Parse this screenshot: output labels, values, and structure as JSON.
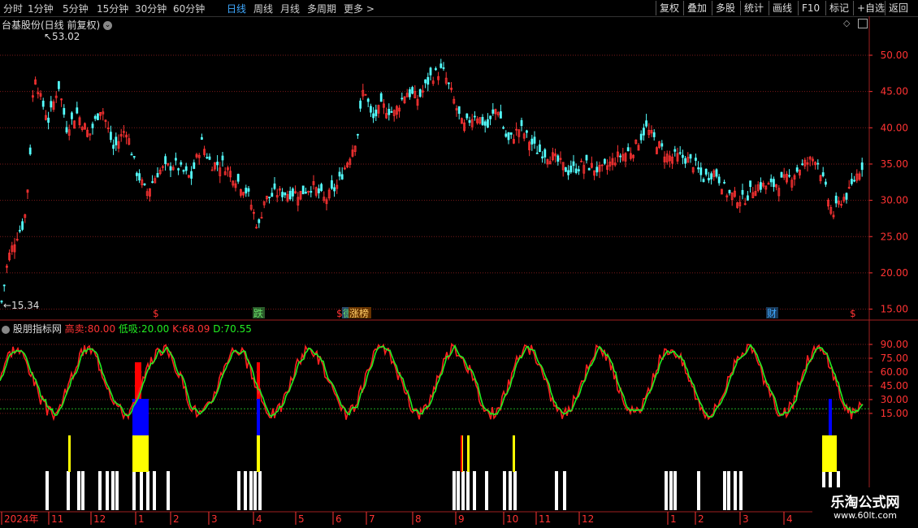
{
  "toolbar": {
    "left_tabs": [
      "分时",
      "1分钟",
      "5分钟",
      "15分钟",
      "30分钟",
      "60分钟",
      "日线",
      "周线",
      "月线",
      "多周期",
      "更多"
    ],
    "active_tab": "日线",
    "right_buttons": [
      "复权",
      "叠加",
      "多股",
      "统计",
      "画线",
      "F10",
      "标记",
      "+自选",
      "返回"
    ]
  },
  "main_chart": {
    "title": "台基股份(日线 前复权)",
    "high_label": "53.02",
    "low_label": "15.34",
    "price_ticks": [
      "50.00",
      "45.00",
      "40.00",
      "35.00",
      "30.00",
      "25.00",
      "20.00",
      "15.00"
    ],
    "markers": [
      "$",
      "跌",
      "$",
      "德",
      "涨榜",
      "财",
      "$"
    ]
  },
  "indicator": {
    "name": "股朋指标网",
    "high_sell_label": "高卖:",
    "high_sell_value": "80.00",
    "low_buy_label": "低吸:",
    "low_buy_value": "20.00",
    "k_label": "K:",
    "k_value": "68.09",
    "d_label": "D:",
    "d_value": "70.55",
    "ticks": [
      "90.00",
      "75.00",
      "60.00",
      "45.00",
      "30.00",
      "15.00"
    ]
  },
  "time_axis": {
    "labels": [
      "2024年",
      "11",
      "12",
      "1",
      "2",
      "3",
      "4",
      "5",
      "6",
      "7",
      "8",
      "9",
      "10",
      "11",
      "12",
      "1",
      "2",
      "3",
      "4",
      "5"
    ]
  },
  "watermark": {
    "line1": "乐淘公式网",
    "line2": "www.60lt.com"
  },
  "colors": {
    "up": "#ff3333",
    "down": "#54ffff",
    "k_line": "#ff2020",
    "d_line": "#22ee22",
    "grid": "#7a1a1a",
    "axis_text": "#ff3333",
    "active_tab": "#3fa9ff"
  }
}
